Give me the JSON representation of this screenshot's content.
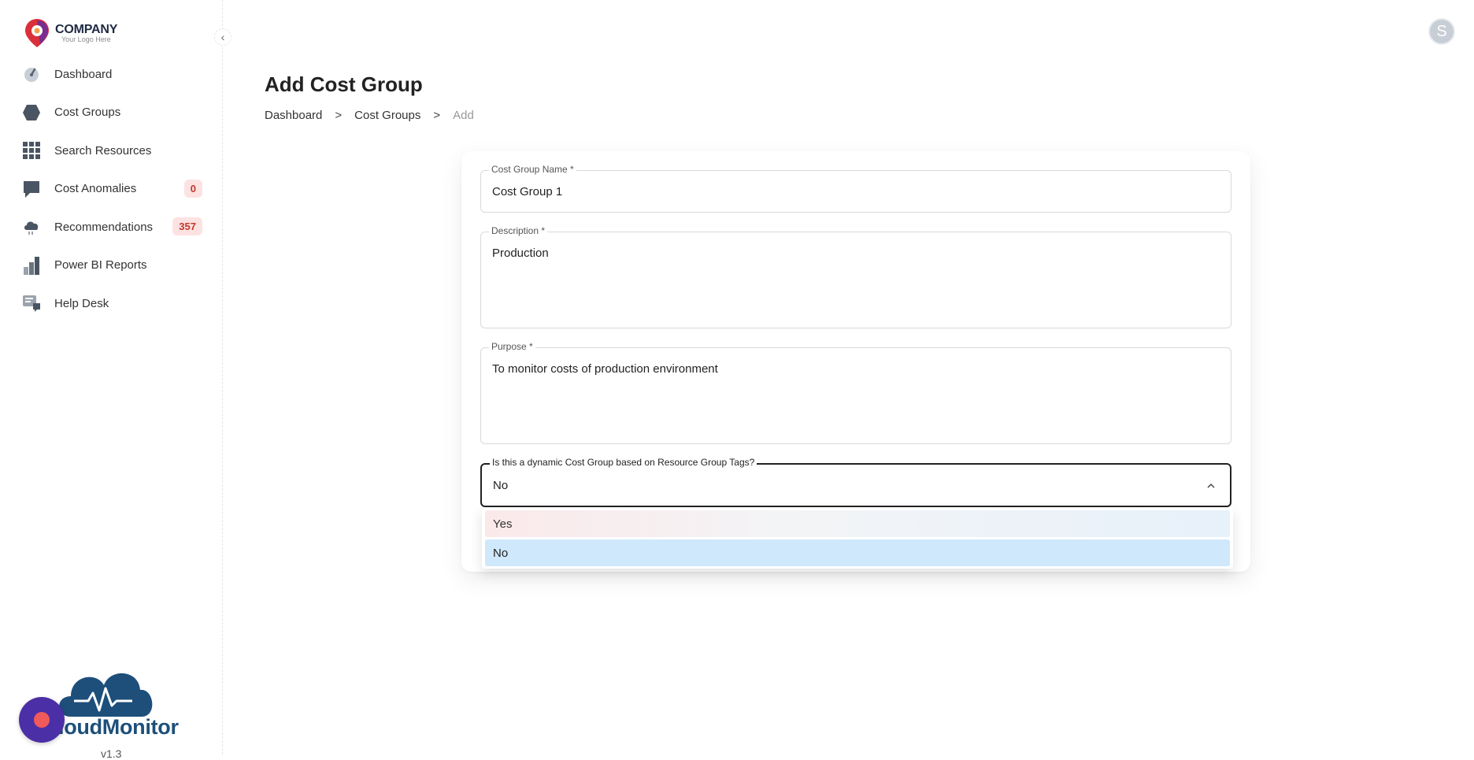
{
  "app": {
    "logo_title": "COMPANY",
    "logo_subtitle": "Your Logo Here",
    "avatar_initial": "S",
    "brand_name": "loudMonitor",
    "version": "v1.3"
  },
  "sidebar": {
    "items": [
      {
        "label": "Dashboard",
        "icon": "gauge-icon"
      },
      {
        "label": "Cost Groups",
        "icon": "hexagon-icon"
      },
      {
        "label": "Search Resources",
        "icon": "grid-icon"
      },
      {
        "label": "Cost Anomalies",
        "icon": "chat-icon",
        "badge": "0"
      },
      {
        "label": "Recommendations",
        "icon": "cloud-icon",
        "badge": "357"
      },
      {
        "label": "Power BI Reports",
        "icon": "bar-chart-icon"
      },
      {
        "label": "Help Desk",
        "icon": "help-desk-icon"
      }
    ]
  },
  "header": {
    "title": "Add Cost Group",
    "breadcrumb": [
      "Dashboard",
      "Cost Groups",
      "Add"
    ],
    "separator": ">"
  },
  "form": {
    "name_label": "Cost Group Name *",
    "name_value": "Cost Group 1",
    "description_label": "Description *",
    "description_value": "Production",
    "purpose_label": "Purpose *",
    "purpose_value": "To monitor costs of production environment",
    "dynamic_label": "Is this a dynamic Cost Group based on Resource Group Tags?",
    "dynamic_value": "No",
    "dynamic_options": [
      "Yes",
      "No"
    ]
  },
  "colors": {
    "accent_select": "#cfe8fb",
    "badge_bg": "#fde2e2",
    "badge_text": "#c0392b",
    "record_button": "#4b2fa6",
    "brand": "#1d4f7a"
  }
}
